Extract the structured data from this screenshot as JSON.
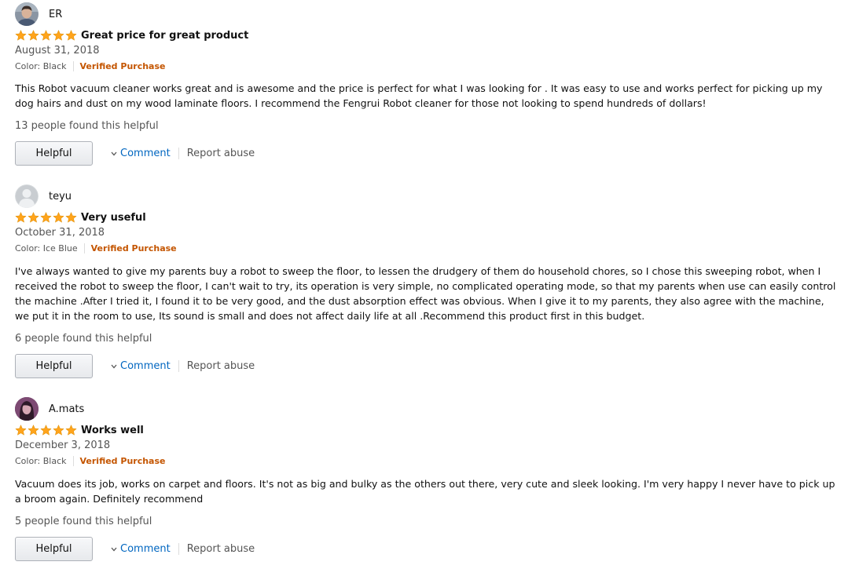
{
  "colors": {
    "verified": "#c45500",
    "link": "#0066c0",
    "star": "#ffa41c",
    "muted": "#555555"
  },
  "reviews": [
    {
      "profile_name": "ER",
      "avatar": "user-photo",
      "rating": 5,
      "title": "Great price for great product",
      "date": "August 31, 2018",
      "format": "Color: Black",
      "verified": "Verified Purchase",
      "body": "This Robot vacuum cleaner works great and is awesome and the price is perfect for what I was looking for . It was easy to use and works perfect for picking up my dog hairs and dust on my wood laminate floors. I recommend the Fengrui Robot cleaner for those not looking to spend hundreds of dollars!",
      "helpful_count": "13 people found this helpful",
      "helpful_label": "Helpful",
      "comment_label": "Comment",
      "report_label": "Report abuse"
    },
    {
      "profile_name": "teyu",
      "avatar": "default-avatar",
      "rating": 5,
      "title": "Very useful",
      "date": "October 31, 2018",
      "format": "Color: Ice Blue",
      "verified": "Verified Purchase",
      "body": "I've always wanted to give my parents buy a robot to sweep the floor, to lessen the drudgery of them do household chores, so I chose this sweeping robot, when I received the robot to sweep the floor, I can't wait to try, its operation is very simple, no complicated operating mode, so that my parents when use can easily control the machine .After I tried it, I found it to be very good, and the dust absorption effect was obvious. When I give it to my parents, they also agree with the machine, we put it in the room to use, Its sound is small and does not affect daily life at all .Recommend this product first in this budget.",
      "helpful_count": "6 people found this helpful",
      "helpful_label": "Helpful",
      "comment_label": "Comment",
      "report_label": "Report abuse"
    },
    {
      "profile_name": "A.mats",
      "avatar": "user-photo",
      "rating": 5,
      "title": "Works well",
      "date": "December 3, 2018",
      "format": "Color: Black",
      "verified": "Verified Purchase",
      "body": "Vacuum does its job, works on carpet and floors. It's not as big and bulky as the others out there, very cute and sleek looking. I'm very happy I never have to pick up a broom again. Definitely recommend",
      "helpful_count": "5 people found this helpful",
      "helpful_label": "Helpful",
      "comment_label": "Comment",
      "report_label": "Report abuse"
    }
  ]
}
